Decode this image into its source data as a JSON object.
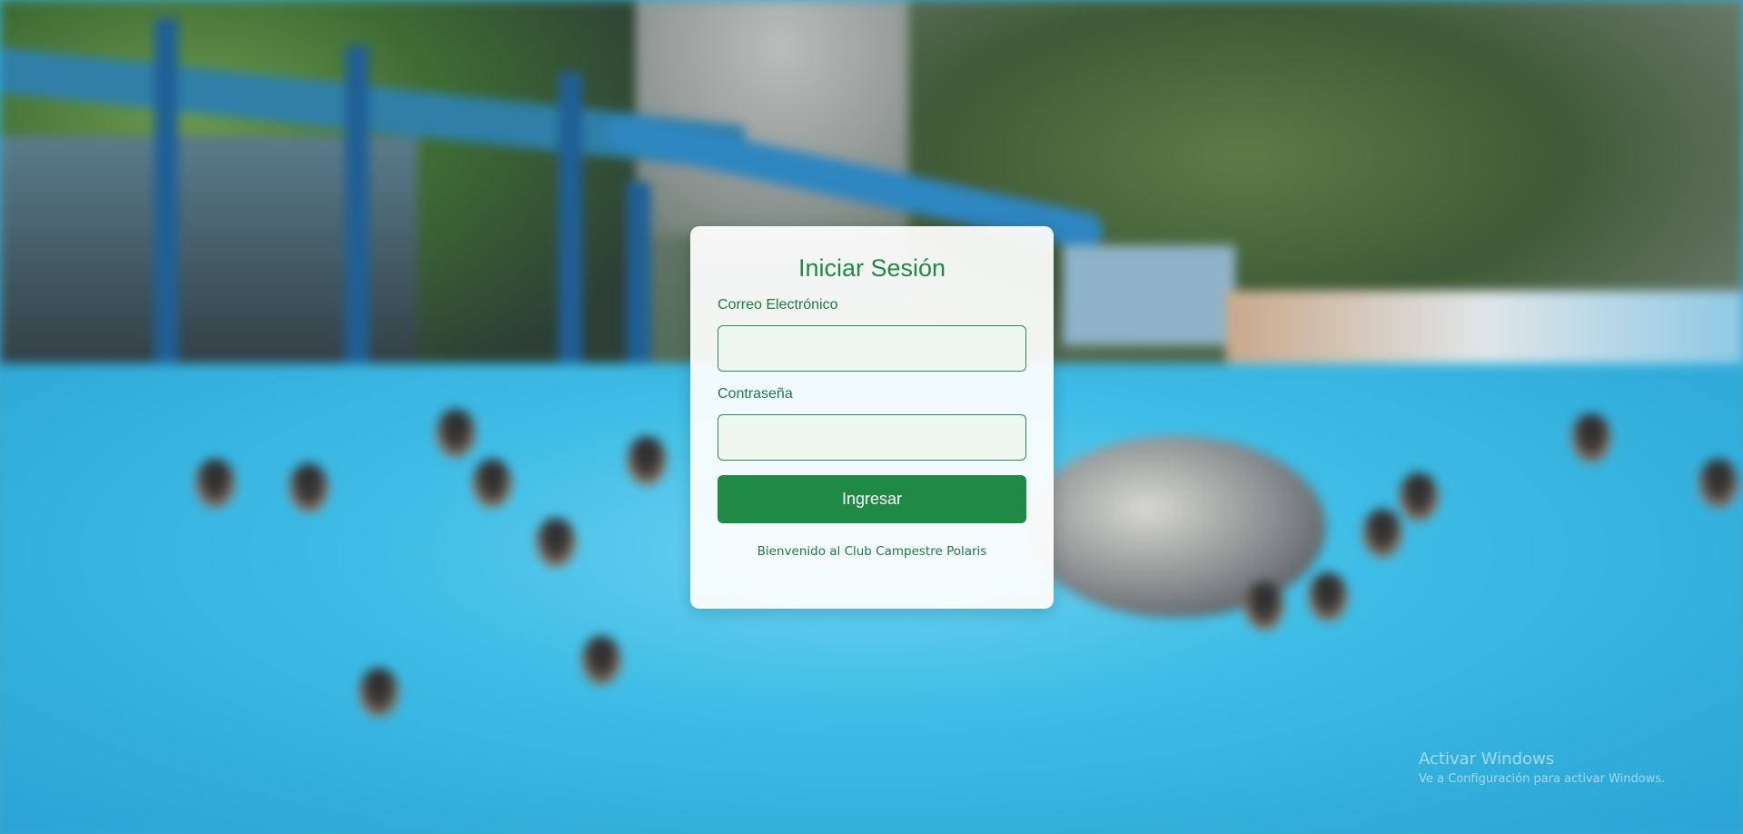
{
  "login": {
    "title": "Iniciar Sesión",
    "email_label": "Correo Electrónico",
    "email_value": "",
    "password_label": "Contraseña",
    "password_value": "",
    "submit_label": "Ingresar",
    "welcome_text": "Bienvenido al Club Campestre Polaris"
  },
  "watermark": {
    "line1": "Activar Windows",
    "line2": "Ve a Configuración para activar Windows."
  },
  "colors": {
    "accent": "#1e8a46",
    "input_bg": "#eef8f1",
    "text_green": "#1e7a40"
  }
}
